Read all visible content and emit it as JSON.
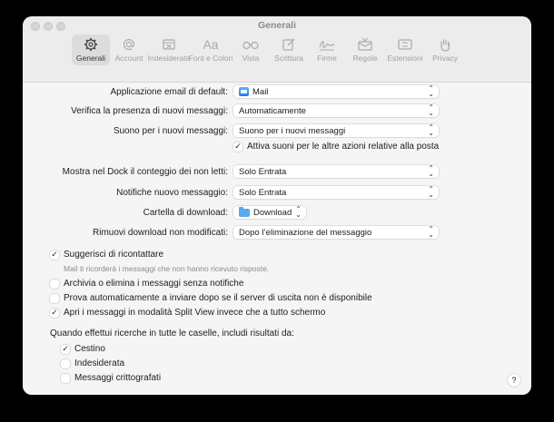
{
  "window": {
    "title": "Generali"
  },
  "toolbar": {
    "items": [
      {
        "label": "Generali",
        "icon": "gear-icon",
        "active": true
      },
      {
        "label": "Account",
        "icon": "at-icon"
      },
      {
        "label": "Indesiderata",
        "icon": "junk-icon"
      },
      {
        "label": "Font e Colori",
        "icon": "font-icon",
        "glyph": "Aa"
      },
      {
        "label": "Vista",
        "icon": "glasses-icon"
      },
      {
        "label": "Scrittura",
        "icon": "compose-icon"
      },
      {
        "label": "Firme",
        "icon": "signature-icon"
      },
      {
        "label": "Regole",
        "icon": "rules-icon"
      },
      {
        "label": "Estensioni",
        "icon": "extensions-icon"
      },
      {
        "label": "Privacy",
        "icon": "hand-icon"
      }
    ]
  },
  "settings": {
    "default_email": {
      "label": "Applicazione email di default:",
      "value": "Mail"
    },
    "check_new": {
      "label": "Verifica la presenza di nuovi messaggi:",
      "value": "Automaticamente"
    },
    "new_sound": {
      "label": "Suono per i nuovi messaggi:",
      "value": "Suono per i nuovi messaggi"
    },
    "play_sounds": {
      "label": "Attiva suoni per le altre azioni relative alla posta",
      "checked": true
    },
    "dock_count": {
      "label": "Mostra nel Dock il conteggio dei non letti:",
      "value": "Solo Entrata"
    },
    "notifications": {
      "label": "Notifiche nuovo messaggio:",
      "value": "Solo Entrata"
    },
    "download_folder": {
      "label": "Cartella di download:",
      "value": "Download"
    },
    "remove_downloads": {
      "label": "Rimuovi download non modificati:",
      "value": "Dopo l’eliminazione del messaggio"
    }
  },
  "options": {
    "suggest": {
      "label": "Suggerisci di ricontattare",
      "checked": true,
      "hint": "Mail ti ricorderà i messaggi che non hanno ricevuto risposte."
    },
    "archive": {
      "label": "Archivia o elimina i messaggi senza notifiche",
      "checked": false
    },
    "retry_send": {
      "label": "Prova automaticamente a inviare dopo se il server di uscita non è disponibile",
      "checked": false
    },
    "split_view": {
      "label": "Apri i messaggi in modalità Split View invece che a tutto schermo",
      "checked": true
    }
  },
  "search": {
    "heading": "Quando effettui ricerche in tutte le caselle, includi risultati da:",
    "items": [
      {
        "label": "Cestino",
        "checked": true
      },
      {
        "label": "Indesiderata",
        "checked": false
      },
      {
        "label": "Messaggi crittografati",
        "checked": false
      }
    ]
  },
  "help_label": "?",
  "check_glyph": "✓"
}
